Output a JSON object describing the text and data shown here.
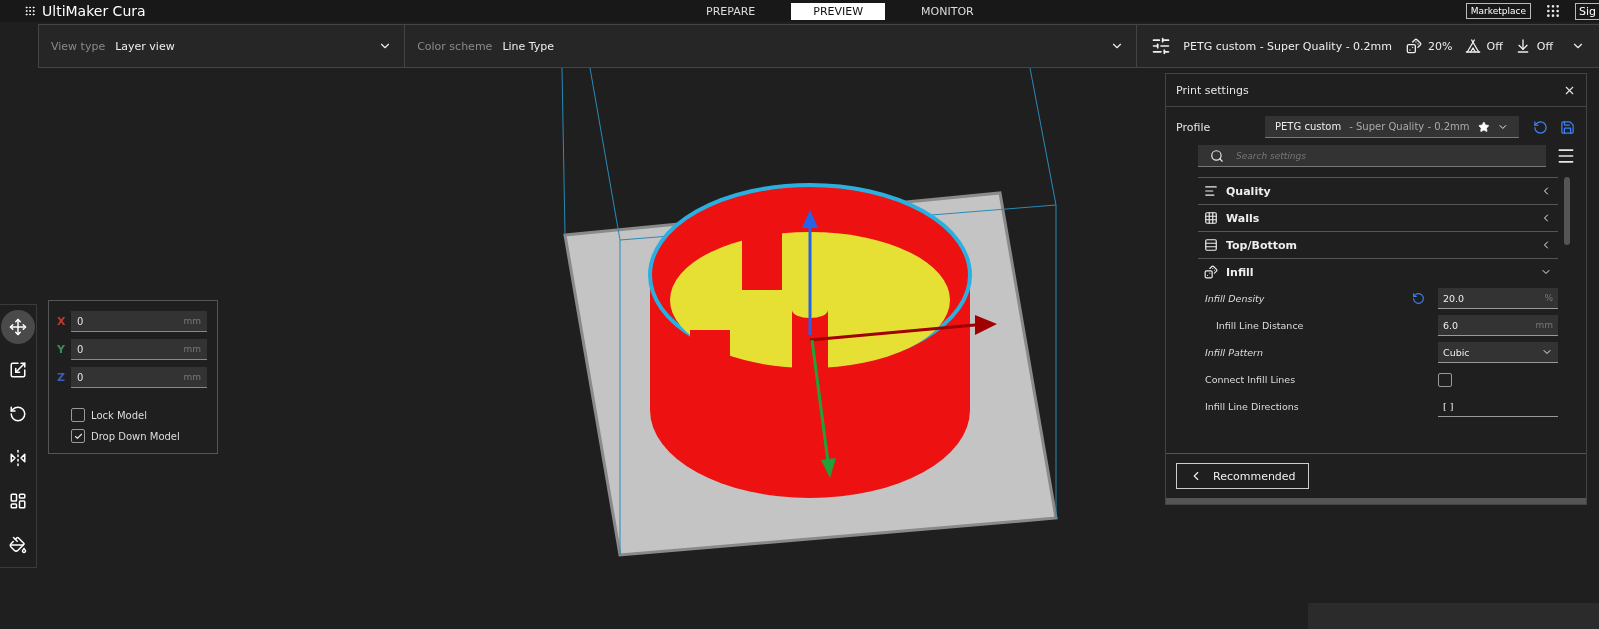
{
  "header": {
    "logo": "UltiMaker Cura",
    "stages": [
      {
        "label": "PREPARE",
        "selected": false
      },
      {
        "label": "PREVIEW",
        "selected": true
      },
      {
        "label": "MONITOR",
        "selected": false
      }
    ],
    "marketplace": "Marketplace",
    "account": "Sig"
  },
  "view_bar": {
    "view_type": {
      "label": "View type",
      "value": "Layer view"
    },
    "color_scheme": {
      "label": "Color scheme",
      "value": "Line Type"
    },
    "summary": {
      "profile": "PETG custom - Super Quality - 0.2mm",
      "infill": "20%",
      "support": "Off",
      "adhesion": "Off"
    }
  },
  "tools": [
    {
      "kind": "move",
      "selected": true
    },
    {
      "kind": "scale",
      "selected": false
    },
    {
      "kind": "rotate",
      "selected": false
    },
    {
      "kind": "mirror",
      "selected": false
    },
    {
      "kind": "per_model",
      "selected": false
    },
    {
      "kind": "support_blocker",
      "selected": false
    }
  ],
  "move_panel": {
    "axes": [
      {
        "axis": "X",
        "value": "0",
        "unit": "mm",
        "color": "#c0392b"
      },
      {
        "axis": "Y",
        "value": "0",
        "unit": "mm",
        "color": "#3d8a55"
      },
      {
        "axis": "Z",
        "value": "0",
        "unit": "mm",
        "color": "#3a5fb5"
      }
    ],
    "options": [
      {
        "label": "Lock Model",
        "checked": false
      },
      {
        "label": "Drop Down Model",
        "checked": true
      }
    ]
  },
  "print_settings": {
    "title": "Print settings",
    "profile_label": "Profile",
    "profile_name": "PETG custom",
    "profile_detail": " - Super Quality - 0.2mm",
    "search": {
      "placeholder": "Search settings"
    },
    "categories": [
      {
        "kind": "quality",
        "label": "Quality",
        "expanded": false
      },
      {
        "kind": "walls",
        "label": "Walls",
        "expanded": false
      },
      {
        "kind": "top_bottom",
        "label": "Top/Bottom",
        "expanded": false
      },
      {
        "kind": "infill",
        "label": "Infill",
        "expanded": true
      }
    ],
    "settings": [
      {
        "kind": "number",
        "label": "Infill Density",
        "value": "20.0",
        "unit": "%",
        "modified": true,
        "resettable": true,
        "children": [
          {
            "kind": "number",
            "label": "Infill Line Distance",
            "value": "6.0",
            "unit": "mm",
            "modified": false,
            "resettable": false
          }
        ]
      },
      {
        "kind": "select",
        "label": "Infill Pattern",
        "value": "Cubic",
        "modified": true,
        "resettable": false
      },
      {
        "kind": "checkbox",
        "label": "Connect Infill Lines",
        "checked": false,
        "modified": false,
        "resettable": false
      },
      {
        "kind": "text",
        "label": "Infill Line Directions",
        "value": "[ ]",
        "modified": false,
        "resettable": false
      }
    ],
    "footer_button": "Recommended"
  }
}
